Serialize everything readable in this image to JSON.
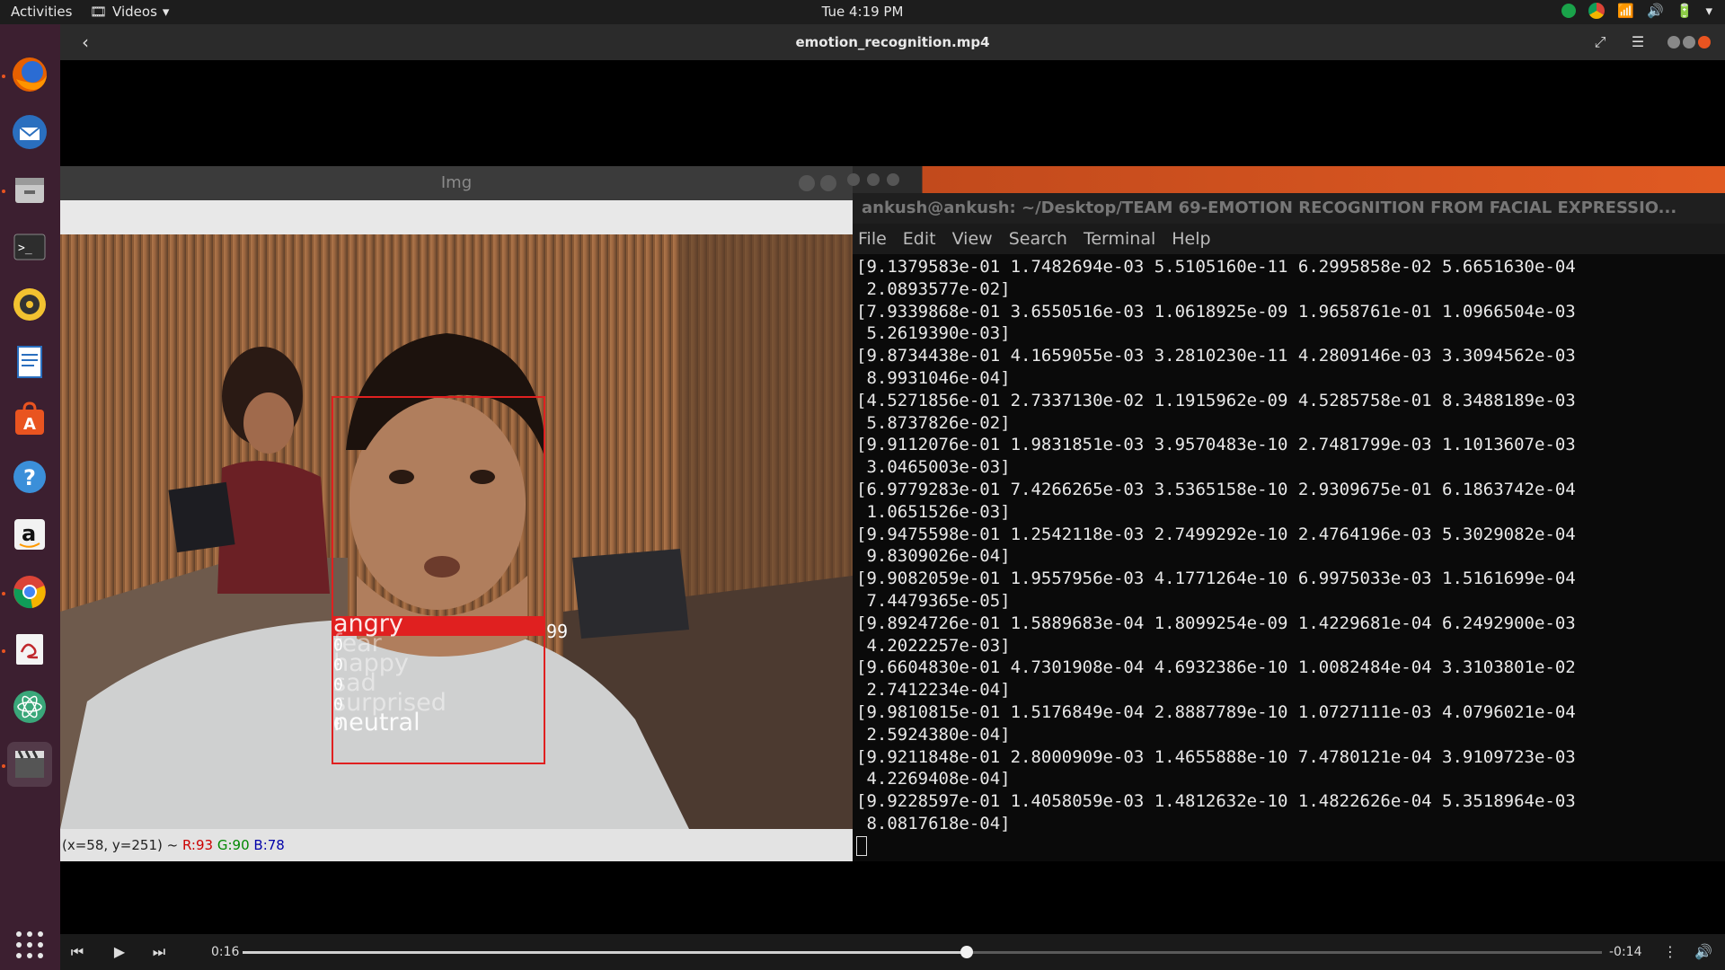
{
  "topbar": {
    "activities": "Activities",
    "app_menu": "Videos",
    "clock": "Tue  4:19 PM"
  },
  "dock": {
    "items": [
      "firefox-icon",
      "thunderbird-icon",
      "files-icon",
      "terminal-icon",
      "rhythmbox-icon",
      "libreoffice-writer-icon",
      "software-center-icon",
      "help-icon",
      "amazon-icon",
      "chrome-icon",
      "document-viewer-icon",
      "atom-icon",
      "videos-icon"
    ]
  },
  "video_window": {
    "title": "emotion_recognition.mp4"
  },
  "img_window": {
    "title": "Img",
    "status": {
      "coords": "(x=58, y=251) ~",
      "r": "R:93",
      "g": "G:90",
      "b": "B:78"
    },
    "detection": {
      "emotions": [
        "angry",
        "fear",
        "happy",
        "sad",
        "surprised",
        "neutral"
      ],
      "top_label": "angry",
      "score_text": "99",
      "zero_markers": [
        "0",
        "0",
        "0",
        "0",
        "0"
      ],
      "box_color": "#e02020"
    }
  },
  "terminal": {
    "title": "ankush@ankush: ~/Desktop/TEAM 69-EMOTION RECOGNITION FROM FACIAL EXPRESSIO...",
    "menu": [
      "File",
      "Edit",
      "View",
      "Search",
      "Terminal",
      "Help"
    ],
    "lines": [
      "[9.1379583e-01 1.7482694e-03 5.5105160e-11 6.2995858e-02 5.6651630e-04",
      " 2.0893577e-02]",
      "[7.9339868e-01 3.6550516e-03 1.0618925e-09 1.9658761e-01 1.0966504e-03",
      " 5.2619390e-03]",
      "[9.8734438e-01 4.1659055e-03 3.2810230e-11 4.2809146e-03 3.3094562e-03",
      " 8.9931046e-04]",
      "[4.5271856e-01 2.7337130e-02 1.1915962e-09 4.5285758e-01 8.3488189e-03",
      " 5.8737826e-02]",
      "[9.9112076e-01 1.9831851e-03 3.9570483e-10 2.7481799e-03 1.1013607e-03",
      " 3.0465003e-03]",
      "[6.9779283e-01 7.4266265e-03 3.5365158e-10 2.9309675e-01 6.1863742e-04",
      " 1.0651526e-03]",
      "[9.9475598e-01 1.2542118e-03 2.7499292e-10 2.4764196e-03 5.3029082e-04",
      " 9.8309026e-04]",
      "[9.9082059e-01 1.9557956e-03 4.1771264e-10 6.9975033e-03 1.5161699e-04",
      " 7.4479365e-05]",
      "[9.8924726e-01 1.5889683e-04 1.8099254e-09 1.4229681e-04 6.2492900e-03",
      " 4.2022257e-03]",
      "[9.6604830e-01 4.7301908e-04 4.6932386e-10 1.0082484e-04 3.3103801e-02",
      " 2.7412234e-04]",
      "[9.9810815e-01 1.5176849e-04 2.8887789e-10 1.0727111e-03 4.0796021e-04",
      " 2.5924380e-04]",
      "[9.9211848e-01 2.8000909e-03 1.4655888e-10 7.4780121e-04 3.9109723e-03",
      " 4.2269408e-04]",
      "[9.9228597e-01 1.4058059e-03 1.4812632e-10 1.4822626e-04 5.3518964e-03",
      " 8.0817618e-04]"
    ]
  },
  "player": {
    "elapsed": "0:16",
    "remaining": "-0:14",
    "progress_fraction": 0.533
  },
  "colors": {
    "dock_bg": "#3c1f30",
    "accent": "#e95420",
    "terminal_bg": "#0a0a0a"
  }
}
